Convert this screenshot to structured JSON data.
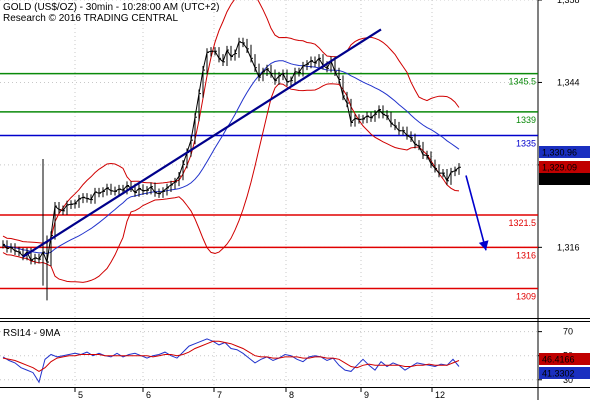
{
  "header": {
    "title": "GOLD (US$/OZ) - 30min - 10:28:00 AM (UTC+2)",
    "subtitle": "Research © 2016 TRADING CENTRAL"
  },
  "colors": {
    "price": "#000000",
    "bollinger": "#d00000",
    "moving_average": "#2233cc",
    "trendline": "#00008b",
    "support": "#e00000",
    "resistance": "#0a8a0a",
    "pivot": "#0000cc",
    "arrow": "#0000cc",
    "grid": "#c8c8c8"
  },
  "chart_data": [
    {
      "type": "line",
      "name": "price",
      "x_ticks": [
        "5",
        "6",
        "7",
        "8",
        "9",
        "12"
      ],
      "y_ticks": [
        1316,
        1330,
        1344,
        1358
      ],
      "y_tick_labels": [
        "1,316",
        "1,330",
        "1,344",
        "1,358"
      ],
      "ylim": [
        1304,
        1358
      ],
      "grid": true,
      "levels": [
        {
          "label": "1345.5",
          "value": 1345.5,
          "kind": "resistance"
        },
        {
          "label": "1339",
          "value": 1339,
          "kind": "resistance"
        },
        {
          "label": "1335",
          "value": 1335,
          "kind": "pivot"
        },
        {
          "label": "1321.5",
          "value": 1321.5,
          "kind": "support"
        },
        {
          "label": "1316",
          "value": 1316,
          "kind": "support"
        },
        {
          "label": "1309",
          "value": 1309,
          "kind": "support"
        }
      ],
      "price_tags": [
        {
          "label": "1,330.96",
          "value": 1330.96,
          "fill": "#1a2fc0"
        },
        {
          "label": "1,329.09",
          "value": 1329.09,
          "fill": "#c00000"
        },
        {
          "label": "1,327.14",
          "value": 1327.14,
          "fill": "#000000"
        }
      ],
      "series": [
        {
          "name": "price",
          "x": [
            0,
            4,
            8,
            12,
            16,
            20,
            24,
            28,
            32,
            36,
            40,
            44,
            48,
            52,
            56,
            60,
            64,
            68,
            72,
            76,
            80,
            84,
            88,
            92,
            96,
            100,
            104,
            108,
            112,
            116,
            120,
            124,
            128,
            132,
            136,
            140,
            144,
            148,
            152,
            156,
            160,
            164,
            168,
            172,
            176,
            180,
            184,
            188,
            192,
            196,
            200,
            204,
            208,
            212,
            216,
            220,
            224,
            228,
            232,
            236,
            240,
            244,
            248,
            252,
            256,
            260,
            264,
            268,
            272,
            276,
            280,
            284,
            288,
            292,
            296,
            300,
            304,
            308,
            312,
            316,
            320,
            324,
            328,
            332,
            336,
            340,
            344,
            348,
            352,
            356,
            360,
            364,
            368,
            372,
            376,
            380,
            384,
            388,
            392,
            396,
            400,
            404,
            408,
            412,
            416,
            420,
            424,
            428,
            432,
            436,
            440,
            444,
            448,
            452,
            456
          ],
          "values": [
            1316.5,
            1315.8,
            1316,
            1315.4,
            1315.2,
            1314.5,
            1315.2,
            1313.8,
            1314.2,
            1314,
            1315.2,
            1313.5,
            1318,
            1323,
            1322.4,
            1322.2,
            1323.2,
            1323.3,
            1323.4,
            1324.2,
            1324.5,
            1324.3,
            1324.1,
            1325.4,
            1325.2,
            1325.5,
            1326.1,
            1325.6,
            1325.5,
            1325.9,
            1325.7,
            1326.5,
            1326.1,
            1325.3,
            1326,
            1325.6,
            1325.7,
            1326.3,
            1325.3,
            1325.1,
            1325.5,
            1326.1,
            1326.6,
            1327.1,
            1328.1,
            1330.1,
            1332.1,
            1334.2,
            1338.1,
            1342.1,
            1346.1,
            1349.1,
            1349.3,
            1349.3,
            1348.1,
            1347.5,
            1349.5,
            1348.4,
            1348.9,
            1350.9,
            1350.7,
            1349.7,
            1348.1,
            1346.5,
            1344.9,
            1345.8,
            1346.3,
            1345.5,
            1344.3,
            1345.1,
            1345.5,
            1344.1,
            1344.3,
            1345.8,
            1345.7,
            1346.8,
            1347.1,
            1347.7,
            1347.3,
            1348.1,
            1346.9,
            1346.4,
            1347.7,
            1345.8,
            1344.5,
            1341.7,
            1340.5,
            1337.2,
            1337.9,
            1337.7,
            1337.8,
            1338.3,
            1338,
            1338.6,
            1339.4,
            1338.6,
            1338.3,
            1337.1,
            1336.6,
            1335.8,
            1335.8,
            1335,
            1334.6,
            1333.5,
            1333.2,
            1331.7,
            1331.6,
            1330.2,
            1329.4,
            1328.6,
            1328.6,
            1327.3,
            1328.8,
            1329,
            1329.6
          ]
        }
      ],
      "annotations": [
        {
          "kind": "trendline",
          "from": {
            "x": 20,
            "y": 1314.4
          },
          "to": {
            "x": 378,
            "y": 1353
          }
        },
        {
          "kind": "arrow",
          "from": {
            "x": 463,
            "y": 1328.2
          },
          "to": {
            "x": 483,
            "y": 1315.5
          }
        }
      ]
    },
    {
      "type": "line",
      "name": "RSI14 - 9MA",
      "title": "RSI14 - 9MA",
      "y_ticks": [
        30,
        50,
        70
      ],
      "y_tick_labels": [
        "30",
        "50",
        "70"
      ],
      "ylim": [
        24,
        78
      ],
      "grid": true,
      "value_tags": [
        {
          "label": "46.4166",
          "value": 46.4166,
          "fill": "#c00000"
        },
        {
          "label": "41.3302",
          "value": 41.3302,
          "fill": "#1a2fc0"
        }
      ],
      "series": [
        {
          "name": "RSI14",
          "x": [
            0,
            6,
            12,
            18,
            24,
            30,
            36,
            42,
            48,
            54,
            60,
            66,
            72,
            78,
            84,
            90,
            96,
            102,
            108,
            114,
            120,
            126,
            132,
            138,
            144,
            150,
            156,
            162,
            168,
            174,
            180,
            186,
            192,
            198,
            204,
            210,
            216,
            222,
            228,
            234,
            240,
            246,
            252,
            258,
            264,
            270,
            276,
            282,
            288,
            294,
            300,
            306,
            312,
            318,
            324,
            330,
            336,
            342,
            348,
            354,
            360,
            366,
            372,
            378,
            384,
            390,
            396,
            402,
            408,
            414,
            420,
            426,
            432,
            438,
            444,
            450,
            456
          ],
          "values": [
            49,
            46,
            44,
            40,
            38,
            36,
            28,
            47,
            51,
            49,
            50,
            51,
            52,
            51,
            53,
            50,
            52,
            50,
            49,
            52,
            49,
            51,
            52,
            50,
            48,
            50,
            51,
            53,
            50,
            48,
            53,
            58,
            60,
            62,
            64,
            62,
            59,
            61,
            56,
            55,
            52,
            48,
            44,
            47,
            49,
            46,
            48,
            51,
            50,
            47,
            45,
            49,
            50,
            49,
            46,
            48,
            42,
            38,
            37,
            42,
            47,
            42,
            38,
            45,
            41,
            44,
            42,
            38,
            41,
            44,
            43,
            42,
            41,
            43,
            42,
            47,
            41
          ]
        },
        {
          "name": "9MA",
          "x": [
            0,
            6,
            12,
            18,
            24,
            30,
            36,
            42,
            48,
            54,
            60,
            66,
            72,
            78,
            84,
            90,
            96,
            102,
            108,
            114,
            120,
            126,
            132,
            138,
            144,
            150,
            156,
            162,
            168,
            174,
            180,
            186,
            192,
            198,
            204,
            210,
            216,
            222,
            228,
            234,
            240,
            246,
            252,
            258,
            264,
            270,
            276,
            282,
            288,
            294,
            300,
            306,
            312,
            318,
            324,
            330,
            336,
            342,
            348,
            354,
            360,
            366,
            372,
            378,
            384,
            390,
            396,
            402,
            408,
            414,
            420,
            426,
            432,
            438,
            444,
            450,
            456
          ],
          "values": [
            48,
            47,
            46,
            44,
            42,
            40,
            37,
            40,
            45,
            48,
            49,
            50,
            50,
            51,
            51,
            51,
            51,
            50,
            50,
            50,
            50,
            50,
            50,
            50,
            50,
            49,
            50,
            51,
            51,
            50,
            51,
            53,
            56,
            58,
            60,
            62,
            62,
            61,
            60,
            58,
            56,
            53,
            50,
            49,
            49,
            48,
            48,
            49,
            49,
            49,
            48,
            48,
            49,
            49,
            48,
            48,
            47,
            44,
            41,
            40,
            42,
            43,
            42,
            42,
            42,
            42,
            42,
            41,
            41,
            42,
            42,
            43,
            42,
            42,
            42,
            44,
            46
          ]
        }
      ]
    }
  ]
}
